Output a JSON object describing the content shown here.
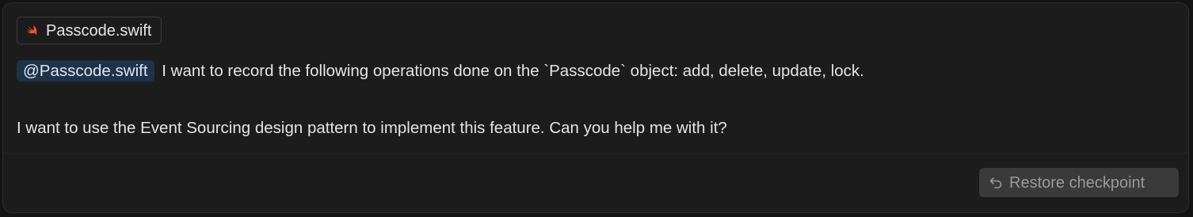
{
  "context": {
    "file_label": "Passcode.swift",
    "file_icon": "swift-icon"
  },
  "message": {
    "mention": "@Passcode.swift",
    "line1": "I want to record the following operations done on the `Passcode` object: add, delete, update, lock.",
    "line2": "I want to use the Event Sourcing design pattern to implement this feature. Can you help me with it?"
  },
  "footer": {
    "restore_label": "Restore checkpoint",
    "restore_icon": "undo-arrow-icon"
  },
  "colors": {
    "background": "#1c1c1c",
    "mention_bg": "#1e3249",
    "swift_orange": "#f05138",
    "button_bg": "#3a3a3a"
  }
}
